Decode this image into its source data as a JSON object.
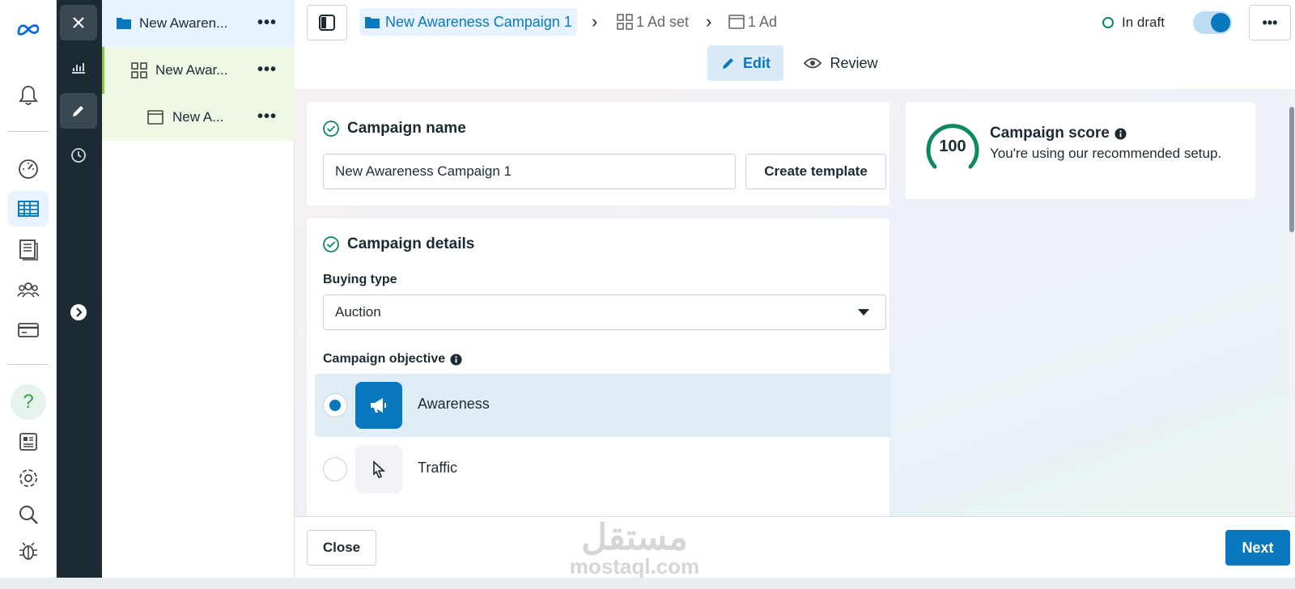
{
  "colors": {
    "accent": "#0a78be",
    "score_ring": "#0c8a5b",
    "dark_strip": "#1c2b33"
  },
  "rail": {
    "icons": [
      "meta-logo-icon",
      "bell-icon",
      "dashboard-icon",
      "table-icon",
      "catalog-icon",
      "audience-icon",
      "billing-icon",
      "help-icon",
      "pages-icon",
      "settings-icon",
      "search-icon",
      "bug-icon"
    ],
    "help_symbol": "?"
  },
  "tree": {
    "items": [
      {
        "label": "New Awaren...",
        "level": "campaign"
      },
      {
        "label": "New Awar...",
        "level": "adset"
      },
      {
        "label": "New A...",
        "level": "ad"
      }
    ],
    "more_label": "•••"
  },
  "breadcrumb": {
    "campaign": "New Awareness Campaign 1",
    "adset": "1 Ad set",
    "ad": "1 Ad",
    "separator": "›"
  },
  "status": {
    "label": "In draft",
    "toggle_on": true
  },
  "modes": {
    "edit": "Edit",
    "review": "Review"
  },
  "campaign_name": {
    "title": "Campaign name",
    "value": "New Awareness Campaign 1",
    "create_template": "Create template"
  },
  "campaign_details": {
    "title": "Campaign details",
    "buying_type_label": "Buying type",
    "buying_type_value": "Auction",
    "objective_label": "Campaign objective",
    "objectives": [
      {
        "label": "Awareness",
        "selected": true
      },
      {
        "label": "Traffic",
        "selected": false
      }
    ]
  },
  "score": {
    "value": "100",
    "title": "Campaign score",
    "subtitle": "You're using our recommended setup.",
    "fraction": 1.0
  },
  "footer": {
    "close": "Close",
    "next": "Next"
  },
  "watermark": {
    "arabic": "مستقل",
    "latin": "mostaql.com"
  }
}
